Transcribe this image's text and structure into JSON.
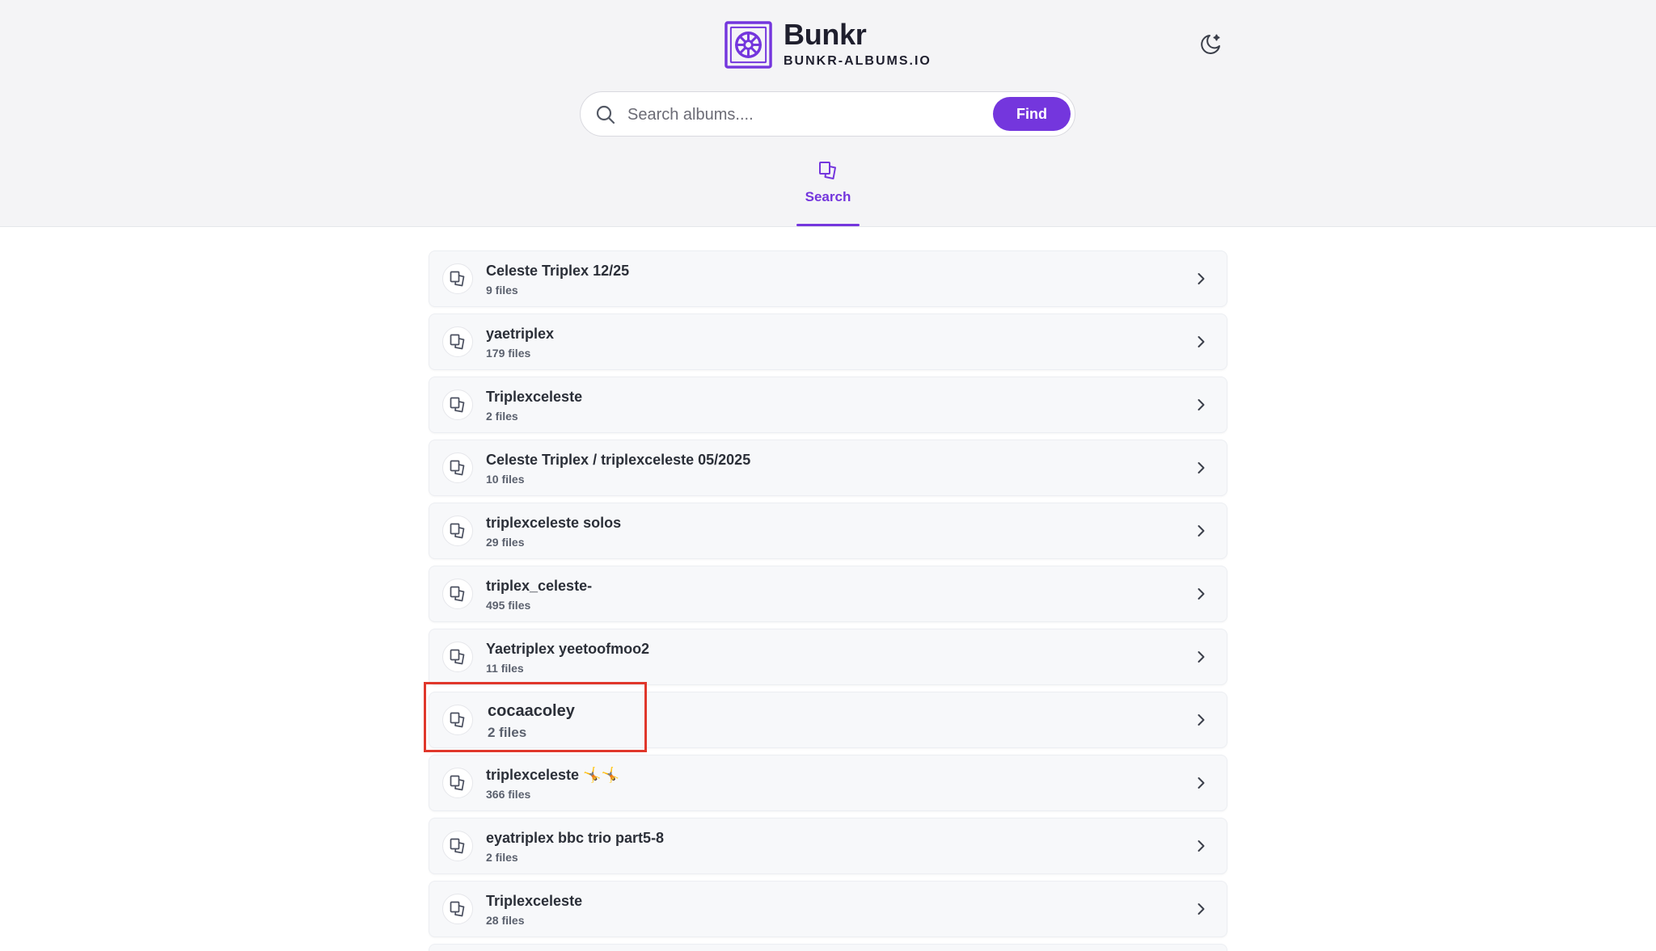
{
  "brand": {
    "name": "Bunkr",
    "domain": "BUNKR-ALBUMS.IO"
  },
  "search": {
    "placeholder": "Search albums....",
    "button_label": "Find"
  },
  "tab": {
    "label": "Search"
  },
  "colors": {
    "accent": "#7436dd",
    "highlight": "#e0372b",
    "header_bg": "#f4f4f6"
  },
  "albums": [
    {
      "title": "Celeste Triplex 12/25",
      "count": "9 files"
    },
    {
      "title": "yaetriplex",
      "count": "179 files"
    },
    {
      "title": "Triplexceleste",
      "count": "2 files"
    },
    {
      "title": "Celeste Triplex / triplexceleste 05/2025",
      "count": "10 files"
    },
    {
      "title": "triplexceleste solos",
      "count": "29 files"
    },
    {
      "title": "triplex_celeste-",
      "count": "495 files"
    },
    {
      "title": "Yaetriplex yeetoofmoo2",
      "count": "11 files"
    },
    {
      "title": "cocaacoley",
      "count": "2 files"
    },
    {
      "title": "triplexceleste 🤸🤸",
      "count": "366 files"
    },
    {
      "title": "eyatriplex bbc trio part5-8",
      "count": "2 files"
    },
    {
      "title": "Triplexceleste",
      "count": "28 files"
    }
  ],
  "icons": {
    "theme_toggle": "moon-sparkle-icon",
    "search": "search-icon",
    "album": "album-icon",
    "row_action": "chevron-right-icon"
  }
}
